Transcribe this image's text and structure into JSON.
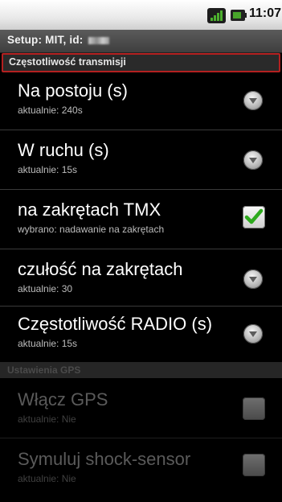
{
  "status_bar": {
    "time": "11:07",
    "icons": [
      "signal-icon",
      "battery-icon"
    ],
    "signal_color": "#4caf2e",
    "battery_color": "#48a52a"
  },
  "title_bar": {
    "title": "Setup:  MIT, id: "
  },
  "category": {
    "label": "Częstotliwość transmisji",
    "border_color": "#b32020"
  },
  "preferences": [
    {
      "title": "Na postoju (s)",
      "summary": "aktualnie: 240s",
      "widget": "dropdown-icon"
    },
    {
      "title": "W ruchu (s)",
      "summary": "aktualnie: 15s",
      "widget": "dropdown-icon"
    },
    {
      "title": "na zakrętach TMX",
      "summary": "wybrano: nadawanie na zakrętach",
      "widget": "checkbox",
      "checked": true
    },
    {
      "title": "czułość na zakrętach",
      "summary": "aktualnie: 30",
      "widget": "dropdown-icon"
    },
    {
      "title": "Częstotliwość RADIO (s)",
      "summary": "aktualnie: 15s",
      "widget": "dropdown-icon"
    }
  ],
  "disabled_category": {
    "label": "Ustawienia GPS"
  },
  "disabled_preferences": [
    {
      "title": "Włącz GPS",
      "summary": "aktualnie: Nie",
      "widget": "checkbox",
      "checked": false
    },
    {
      "title": "Symuluj shock-sensor",
      "summary": "aktualnie: Nie",
      "widget": "checkbox",
      "checked": false
    }
  ]
}
